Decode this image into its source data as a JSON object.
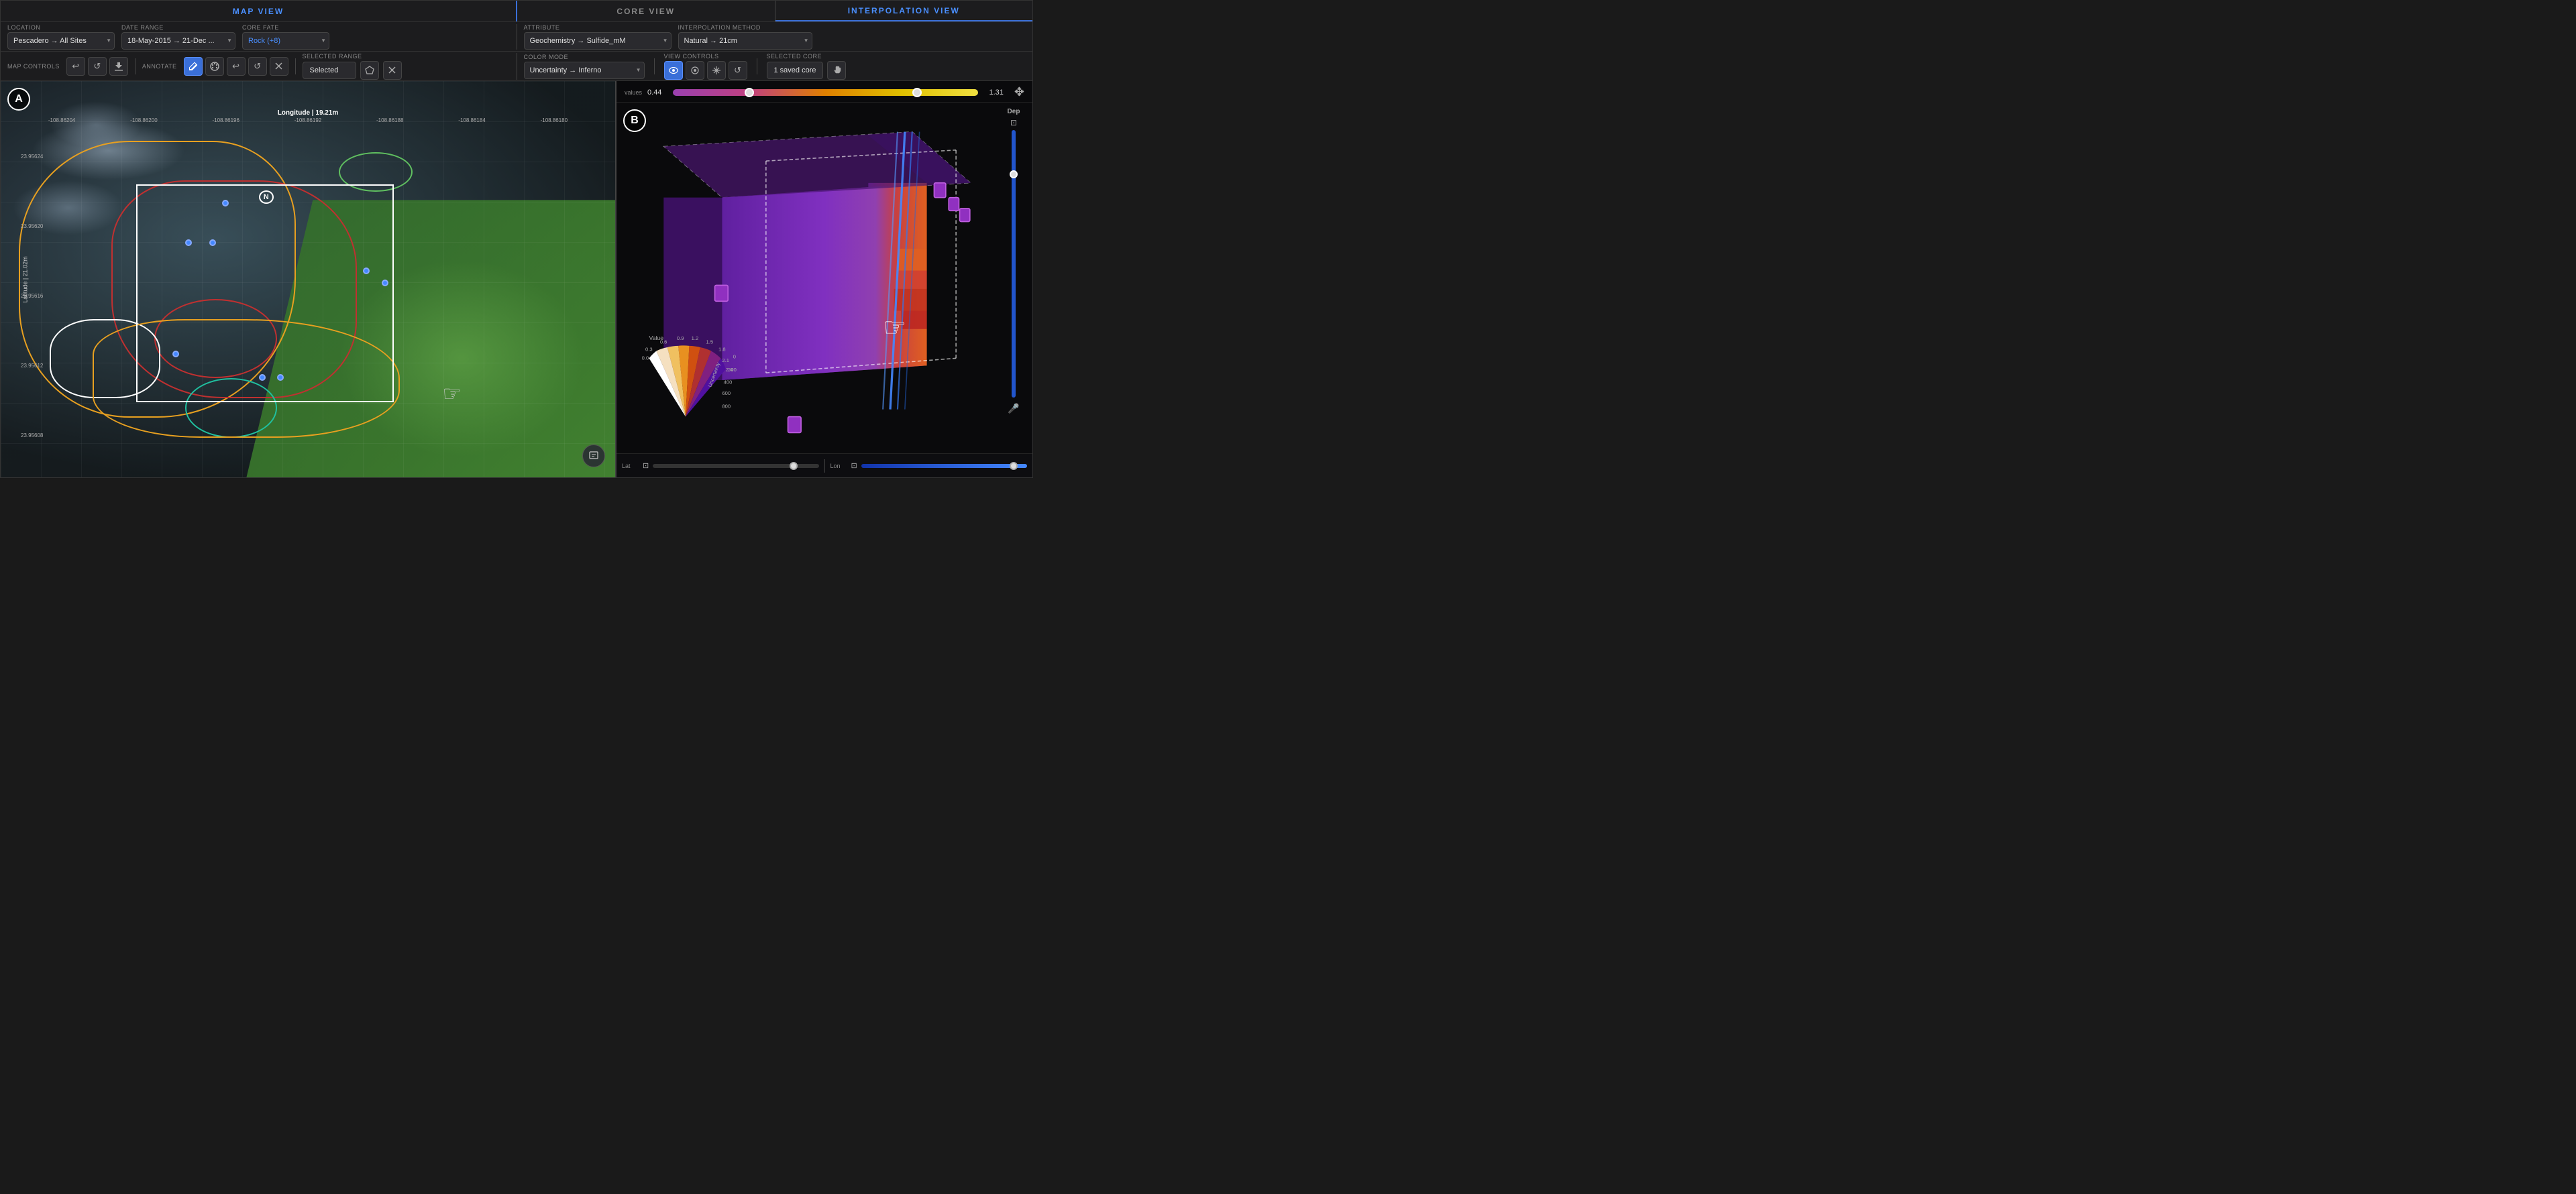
{
  "header": {
    "map_view_title": "MAP VIEW",
    "core_view_title": "CORE VIEW",
    "interp_view_title": "INTERPOLATION VIEW"
  },
  "controls_row1": {
    "left": {
      "location_label": "Location",
      "location_value": "Pescadero → All Sites",
      "date_range_label": "Date Range",
      "date_range_value": "18-May-2015 → 21-Dec ...",
      "core_fate_label": "Core Fate",
      "core_fate_value": "Rock (+8)"
    },
    "right": {
      "attribute_label": "Attribute",
      "attribute_value": "Geochemistry → Sulfide_mM",
      "interp_method_label": "Interpolation Method",
      "interp_method_value": "Natural → 21cm"
    }
  },
  "controls_row2": {
    "left": {
      "map_controls_label": "Map Controls",
      "annotate_label": "Annotate",
      "selected_range_label": "Selected Range",
      "selected_range_value": "Selected"
    },
    "right": {
      "color_mode_label": "Color Mode",
      "color_mode_value": "Uncertainty → Inferno",
      "view_controls_label": "View Controls",
      "selected_core_label": "Selected Core",
      "selected_core_value": "1 saved core"
    }
  },
  "map_view": {
    "label_a": "A",
    "longitude_title": "Longitude | 19.21m",
    "latitude_label": "Latitude | 21.02m",
    "lon_ticks": [
      "-108.86204",
      "-108.86200",
      "-108.86196",
      "-108.86192",
      "-108.86188",
      "-108.86184",
      "-108.86180"
    ],
    "lat_ticks": [
      "23.95624",
      "23.95620",
      "23.95616",
      "23.95612",
      "23.95608"
    ],
    "north_label": "N",
    "cursor_symbol": "☞"
  },
  "interp_view": {
    "label_b": "B",
    "value_label": "values",
    "slider_min": "0.44",
    "slider_max": "1.31",
    "slider_left_pos": "25",
    "slider_right_pos": "80",
    "depth_label": "Dep",
    "lat_label": "Lat",
    "lon_label": "Lon",
    "cursor_symbol": "☞",
    "legend_values": [
      "0.0",
      "0.3",
      "0.6",
      "0.9",
      "1.2",
      "1.5",
      "1.8",
      "2.1",
      "2.4"
    ],
    "legend_title": "Value",
    "legend_uncertainty": "Uncertainty",
    "legend_ticks": [
      "0",
      "200",
      "400",
      "600",
      "800"
    ]
  },
  "buttons": {
    "undo": "↩",
    "redo": "↺",
    "download": "⬇",
    "pen": "✏",
    "palette": "🎨",
    "undo2": "↩",
    "redo2": "↺",
    "delete": "✕",
    "polygon": "⬡",
    "close": "✕",
    "eye": "👁",
    "layers": "⊞",
    "move": "↕",
    "refresh": "↺",
    "hand": "✋",
    "move2d": "✥",
    "mic": "🎤"
  }
}
